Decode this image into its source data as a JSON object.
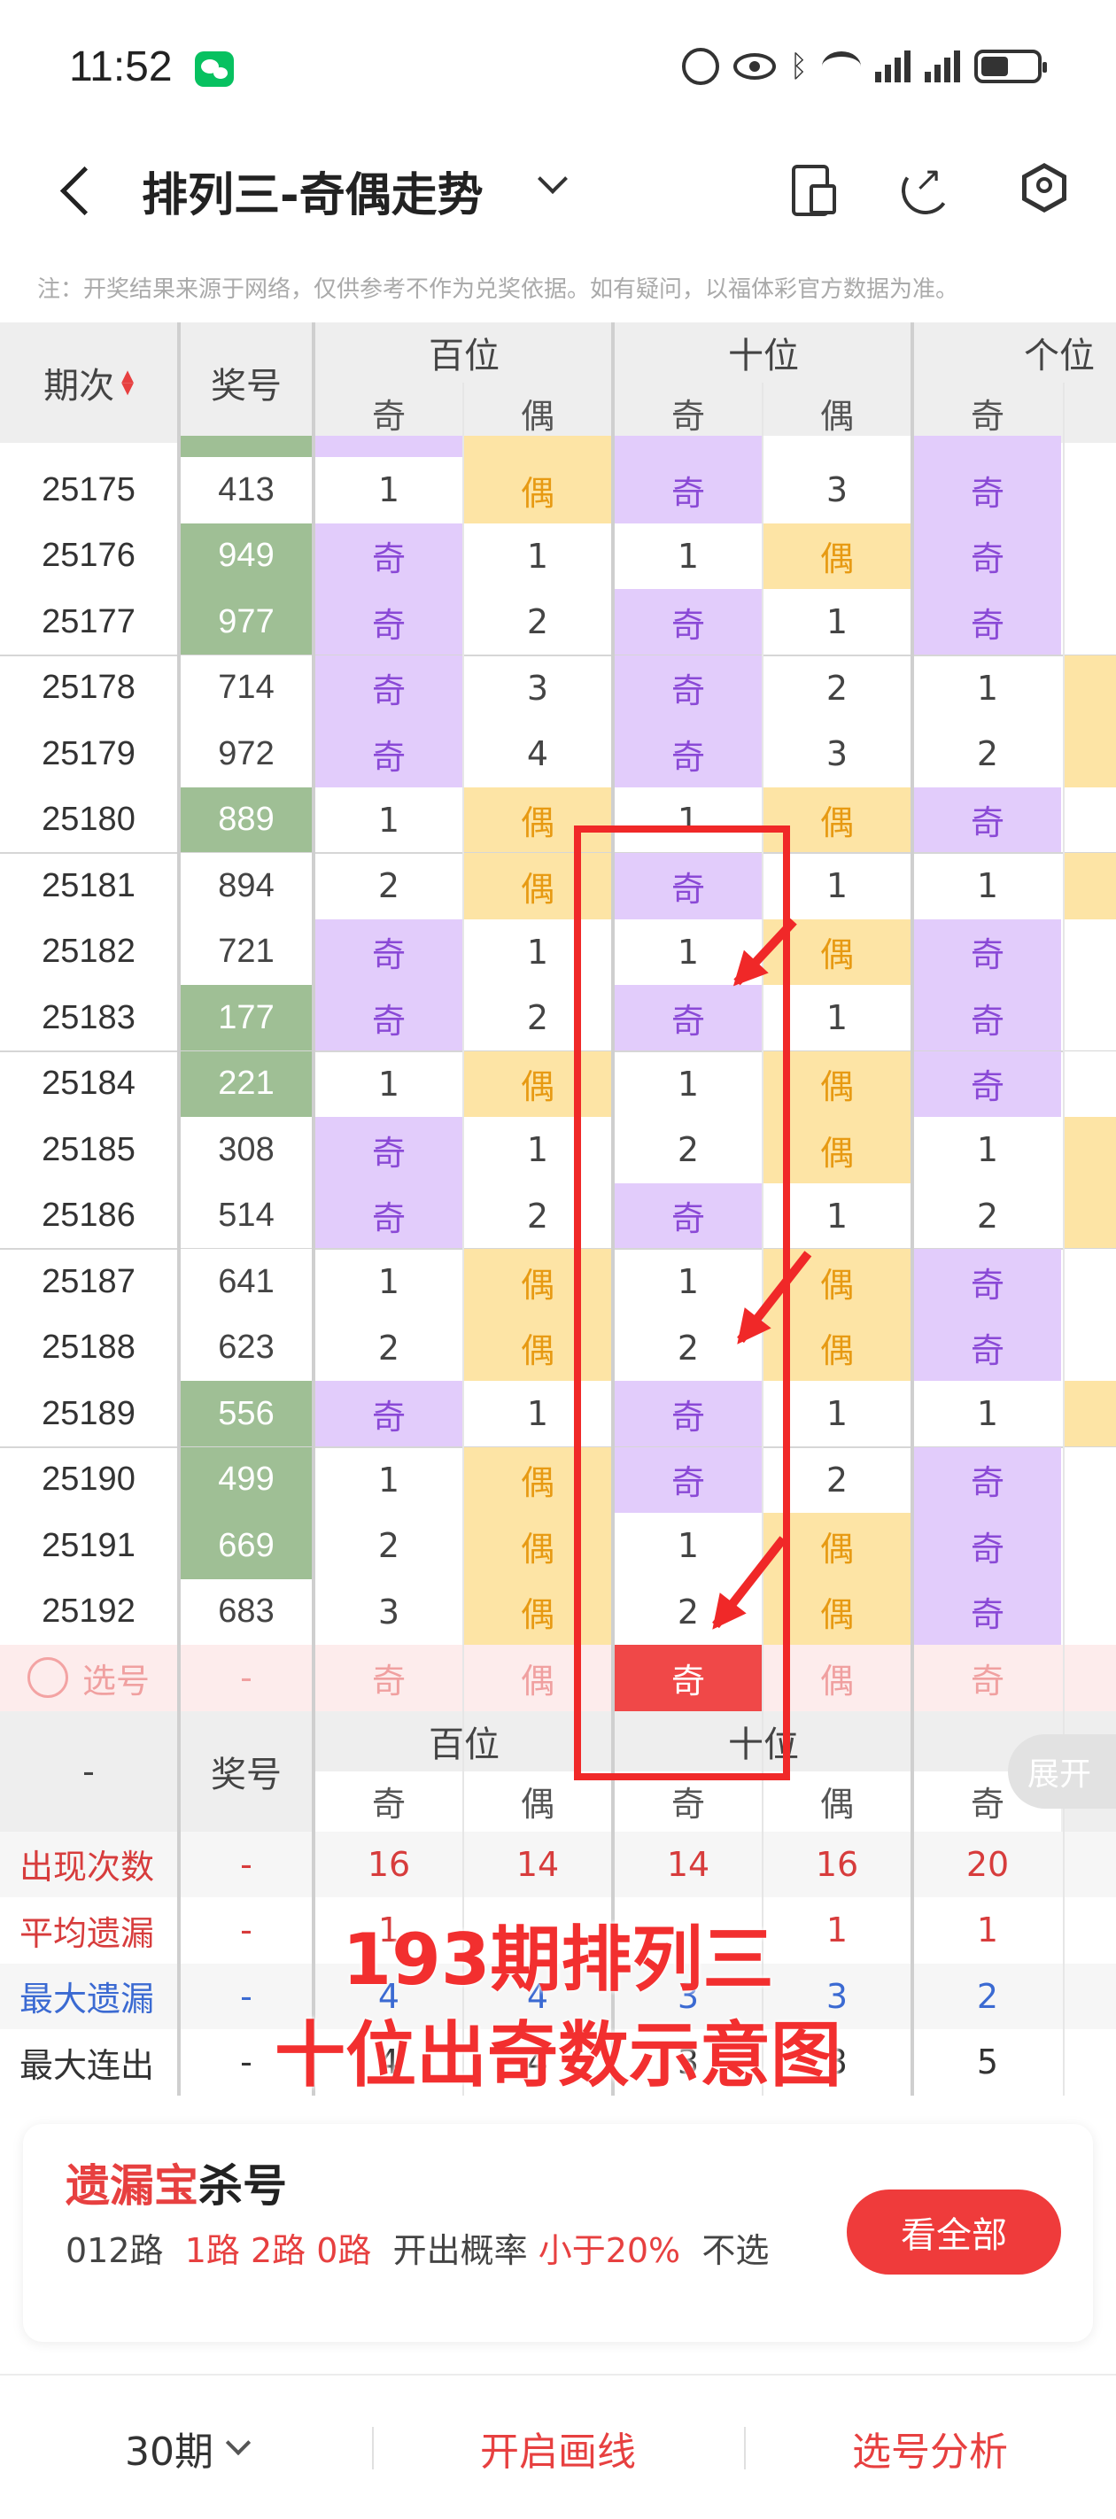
{
  "status_bar": {
    "time": "11:52"
  },
  "header": {
    "title": "排列三-奇偶走势"
  },
  "notice": "注：开奖结果来源于网络，仅供参考不作为兑奖依据。如有疑问，以福体彩官方数据为准。",
  "table": {
    "col_issue": "期次",
    "col_number": "奖号",
    "groups": [
      "百位",
      "十位",
      "个位"
    ],
    "sub_odd": "奇",
    "sub_even": "偶",
    "rows": [
      {
        "issue": "25175",
        "number": "413",
        "green": false,
        "cells": [
          "1",
          "偶",
          "奇",
          "3",
          "奇"
        ]
      },
      {
        "issue": "25176",
        "number": "949",
        "green": true,
        "cells": [
          "奇",
          "1",
          "1",
          "偶",
          "奇"
        ]
      },
      {
        "issue": "25177",
        "number": "977",
        "green": true,
        "cells": [
          "奇",
          "2",
          "奇",
          "1",
          "奇"
        ]
      },
      {
        "issue": "25178",
        "number": "714",
        "green": false,
        "cells": [
          "奇",
          "3",
          "奇",
          "2",
          "1"
        ]
      },
      {
        "issue": "25179",
        "number": "972",
        "green": false,
        "cells": [
          "奇",
          "4",
          "奇",
          "3",
          "2"
        ]
      },
      {
        "issue": "25180",
        "number": "889",
        "green": true,
        "cells": [
          "1",
          "偶",
          "1",
          "偶",
          "奇"
        ]
      },
      {
        "issue": "25181",
        "number": "894",
        "green": false,
        "cells": [
          "2",
          "偶",
          "奇",
          "1",
          "1"
        ]
      },
      {
        "issue": "25182",
        "number": "721",
        "green": false,
        "cells": [
          "奇",
          "1",
          "1",
          "偶",
          "奇"
        ]
      },
      {
        "issue": "25183",
        "number": "177",
        "green": true,
        "cells": [
          "奇",
          "2",
          "奇",
          "1",
          "奇"
        ]
      },
      {
        "issue": "25184",
        "number": "221",
        "green": true,
        "cells": [
          "1",
          "偶",
          "1",
          "偶",
          "奇"
        ]
      },
      {
        "issue": "25185",
        "number": "308",
        "green": false,
        "cells": [
          "奇",
          "1",
          "2",
          "偶",
          "1"
        ]
      },
      {
        "issue": "25186",
        "number": "514",
        "green": false,
        "cells": [
          "奇",
          "2",
          "奇",
          "1",
          "2"
        ]
      },
      {
        "issue": "25187",
        "number": "641",
        "green": false,
        "cells": [
          "1",
          "偶",
          "1",
          "偶",
          "奇"
        ]
      },
      {
        "issue": "25188",
        "number": "623",
        "green": false,
        "cells": [
          "2",
          "偶",
          "2",
          "偶",
          "奇"
        ]
      },
      {
        "issue": "25189",
        "number": "556",
        "green": true,
        "cells": [
          "奇",
          "1",
          "奇",
          "1",
          "1"
        ]
      },
      {
        "issue": "25190",
        "number": "499",
        "green": true,
        "cells": [
          "1",
          "偶",
          "奇",
          "2",
          "奇"
        ]
      },
      {
        "issue": "25191",
        "number": "669",
        "green": true,
        "cells": [
          "2",
          "偶",
          "1",
          "偶",
          "奇"
        ]
      },
      {
        "issue": "25192",
        "number": "683",
        "green": false,
        "cells": [
          "3",
          "偶",
          "2",
          "偶",
          "奇"
        ]
      }
    ],
    "pick_row": {
      "label": "选号",
      "number": "-",
      "cells": [
        "奇",
        "偶",
        "奇",
        "偶",
        "奇"
      ],
      "selected_index": 2
    },
    "footer_header": {
      "issue": "-",
      "number": "奖号",
      "groups": [
        "百位",
        "十位"
      ]
    },
    "stats": [
      {
        "label": "出现次数",
        "number": "-",
        "values": [
          "16",
          "14",
          "14",
          "16",
          "20"
        ],
        "color": "red"
      },
      {
        "label": "平均遗漏",
        "number": "-",
        "values": [
          "1",
          "",
          "",
          "1",
          "1"
        ],
        "color": "red"
      },
      {
        "label": "最大遗漏",
        "number": "-",
        "values": [
          "4",
          "4",
          "3",
          "3",
          "2"
        ],
        "color": "blue"
      },
      {
        "label": "最大连出",
        "number": "-",
        "values": [
          "4",
          "4",
          "3",
          "3",
          "5"
        ],
        "color": "dark"
      }
    ],
    "expand_label": "展开"
  },
  "annotation": {
    "line1": "193期排列三",
    "line2": "十位出奇数示意图"
  },
  "card": {
    "title_red": "遗漏宝",
    "title_black": "杀号",
    "prefix": "012路",
    "routes": "1路 2路 0路",
    "prob_label": "开出概率",
    "prob_value": "小于20%",
    "suffix": "不选",
    "button": "看全部"
  },
  "bottom_bar": {
    "periods": "30期",
    "draw_line": "开启画线",
    "analysis": "选号分析"
  },
  "colors": {
    "odd_bg": "#e2ccfb",
    "even_bg": "#fde4a5",
    "green_bg": "#9fbf95",
    "accent_red": "#ef3b3b"
  }
}
